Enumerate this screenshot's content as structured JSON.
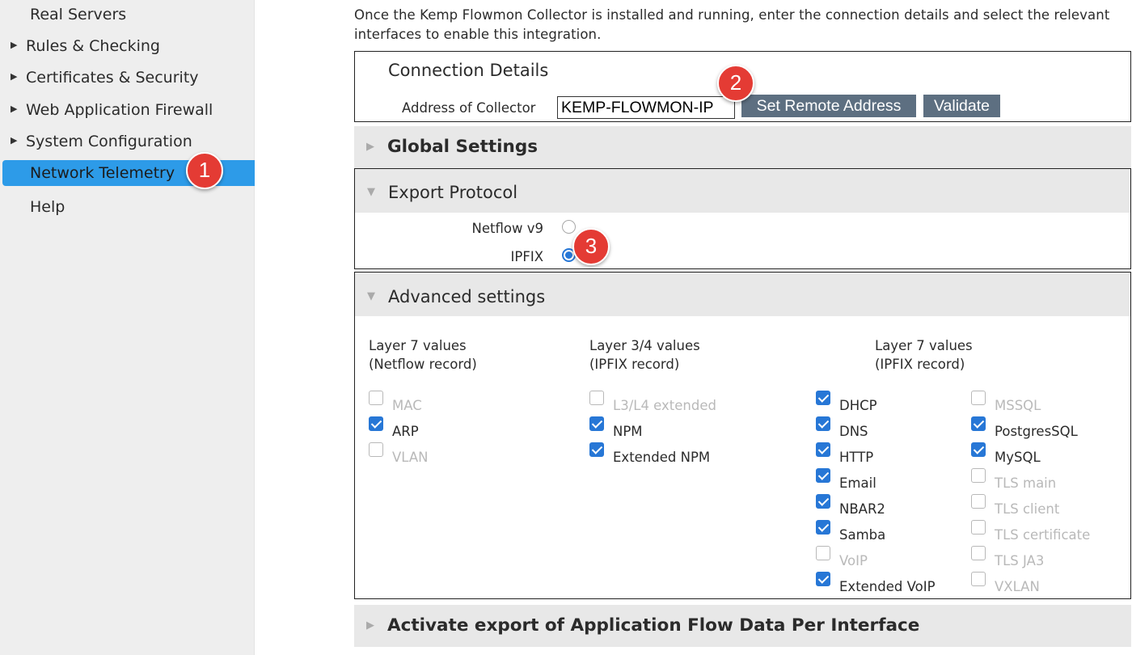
{
  "sidebar": {
    "items": [
      {
        "label": "Real Servers",
        "expandable": false,
        "active": false
      },
      {
        "label": "Rules & Checking",
        "expandable": true,
        "active": false
      },
      {
        "label": "Certificates & Security",
        "expandable": true,
        "active": false
      },
      {
        "label": "Web Application Firewall",
        "expandable": true,
        "active": false
      },
      {
        "label": "System Configuration",
        "expandable": true,
        "active": false
      },
      {
        "label": "Network Telemetry",
        "expandable": false,
        "active": true
      },
      {
        "label": "Help",
        "expandable": false,
        "active": false
      }
    ]
  },
  "markers": {
    "one": "1",
    "two": "2",
    "three": "3"
  },
  "intro": "Once the Kemp Flowmon Collector is installed and running, enter the connection details and select the relevant interfaces to enable this integration.",
  "connection": {
    "title": "Connection Details",
    "address_label": "Address of Collector",
    "address_value": "KEMP-FLOWMON-IP",
    "set_remote_label": "Set Remote Address",
    "validate_label": "Validate"
  },
  "global_settings": {
    "title": "Global Settings"
  },
  "export_protocol": {
    "title": "Export Protocol",
    "options": [
      {
        "label": "Netflow v9",
        "selected": false
      },
      {
        "label": "IPFIX",
        "selected": true
      }
    ]
  },
  "advanced": {
    "title": "Advanced settings",
    "columns": [
      {
        "heading_line1": "Layer 7 values",
        "heading_line2": "(Netflow record)"
      },
      {
        "heading_line1": "Layer 3/4 values",
        "heading_line2": "(IPFIX record)"
      },
      {
        "heading_line1": "Layer 7 values",
        "heading_line2": "(IPFIX record)"
      }
    ],
    "netflow_l7": [
      {
        "label": "MAC",
        "checked": false,
        "enabled": false
      },
      {
        "label": "ARP",
        "checked": true,
        "enabled": true
      },
      {
        "label": "VLAN",
        "checked": false,
        "enabled": false
      }
    ],
    "ipfix_l34": [
      {
        "label": "L3/L4 extended",
        "checked": false,
        "enabled": false
      },
      {
        "label": "NPM",
        "checked": true,
        "enabled": true
      },
      {
        "label": "Extended NPM",
        "checked": true,
        "enabled": true
      }
    ],
    "ipfix_l7_a": [
      {
        "label": "DHCP",
        "checked": true,
        "enabled": true
      },
      {
        "label": "DNS",
        "checked": true,
        "enabled": true
      },
      {
        "label": "HTTP",
        "checked": true,
        "enabled": true
      },
      {
        "label": "Email",
        "checked": true,
        "enabled": true
      },
      {
        "label": "NBAR2",
        "checked": true,
        "enabled": true
      },
      {
        "label": "Samba",
        "checked": true,
        "enabled": true
      },
      {
        "label": "VoIP",
        "checked": false,
        "enabled": false
      },
      {
        "label": "Extended VoIP",
        "checked": true,
        "enabled": true
      }
    ],
    "ipfix_l7_b": [
      {
        "label": "MSSQL",
        "checked": false,
        "enabled": false
      },
      {
        "label": "PostgresSQL",
        "checked": true,
        "enabled": true
      },
      {
        "label": "MySQL",
        "checked": true,
        "enabled": true
      },
      {
        "label": "TLS main",
        "checked": false,
        "enabled": false
      },
      {
        "label": "TLS client",
        "checked": false,
        "enabled": false
      },
      {
        "label": "TLS certificate",
        "checked": false,
        "enabled": false
      },
      {
        "label": "TLS JA3",
        "checked": false,
        "enabled": false
      },
      {
        "label": "VXLAN",
        "checked": false,
        "enabled": false
      }
    ]
  },
  "activate_export": {
    "title": "Activate export of Application Flow Data Per Interface"
  },
  "colors": {
    "accent": "#2d9be8",
    "button": "#5d6f81",
    "marker": "#e43b34",
    "checkbox": "#2777d6"
  }
}
